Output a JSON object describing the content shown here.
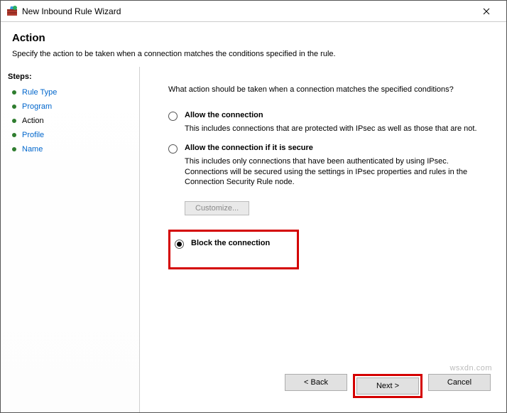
{
  "window": {
    "title": "New Inbound Rule Wizard"
  },
  "header": {
    "heading": "Action",
    "description": "Specify the action to be taken when a connection matches the conditions specified in the rule."
  },
  "sidebar": {
    "title": "Steps:",
    "items": [
      {
        "label": "Rule Type",
        "current": false
      },
      {
        "label": "Program",
        "current": false
      },
      {
        "label": "Action",
        "current": true
      },
      {
        "label": "Profile",
        "current": false
      },
      {
        "label": "Name",
        "current": false
      }
    ]
  },
  "content": {
    "question": "What action should be taken when a connection matches the specified conditions?",
    "opt_allow": {
      "label": "Allow the connection",
      "desc": "This includes connections that are protected with IPsec as well as those that are not."
    },
    "opt_secure": {
      "label": "Allow the connection if it is secure",
      "desc": "This includes only connections that have been authenticated by using IPsec.  Connections will be secured using the settings in IPsec properties and rules in the Connection Security Rule node.",
      "customize": "Customize..."
    },
    "opt_block": {
      "label": "Block the connection"
    }
  },
  "footer": {
    "back": "< Back",
    "next": "Next >",
    "cancel": "Cancel"
  },
  "watermark": "wsxdn.com"
}
